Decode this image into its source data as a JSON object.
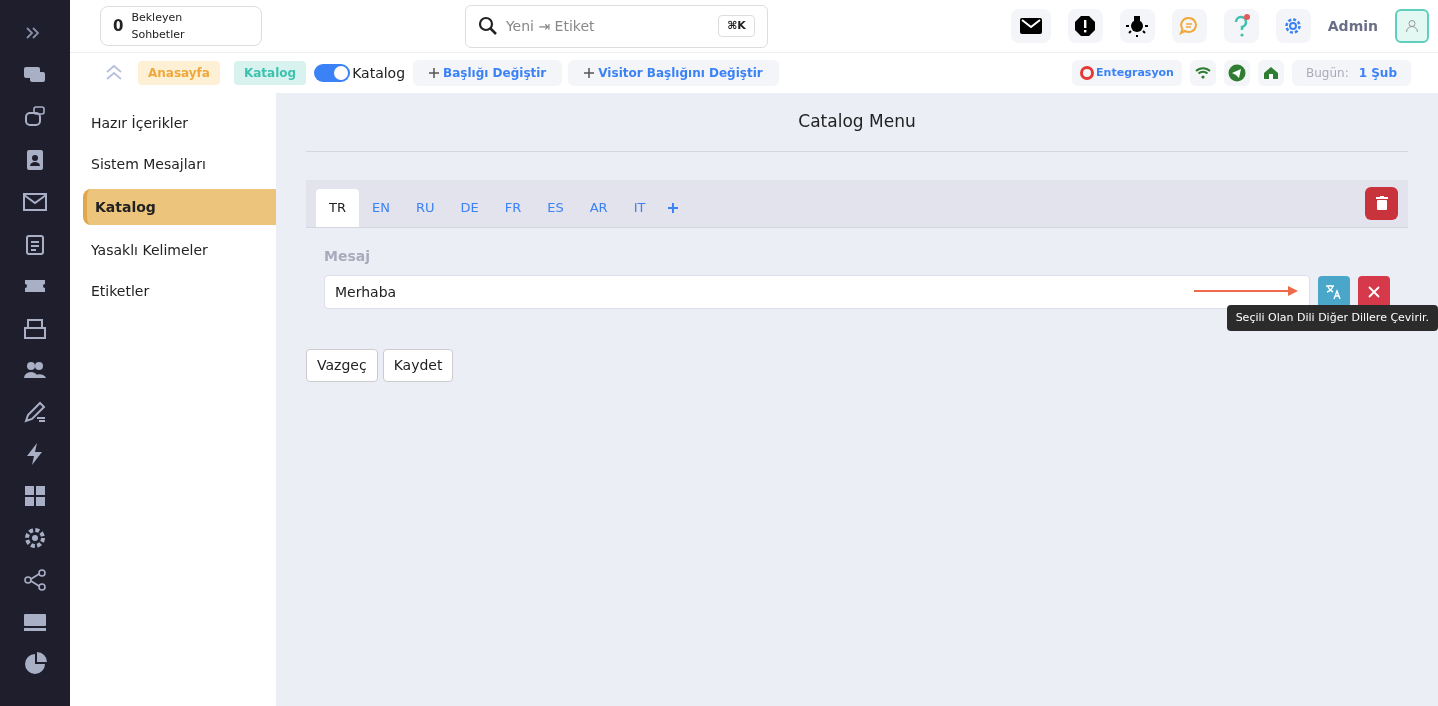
{
  "header": {
    "waiting": {
      "count": "0",
      "label": "Bekleyen Sohbetler"
    },
    "search": {
      "placeholder": "Yeni ⇥ Etiket",
      "shortcut": "⌘K"
    },
    "user": "Admin"
  },
  "toolbar": {
    "breadcrumbs": [
      {
        "label": "Anasayfa",
        "kind": "home"
      },
      {
        "label": "Katalog",
        "kind": "current"
      }
    ],
    "toggle": {
      "label": "Katalog",
      "on": true
    },
    "actions": [
      "Başlığı Değiştir",
      "Visitor Başlığını Değiştir"
    ],
    "integration": "Entegrasyon",
    "today_label": "Bugün:",
    "today_value": "1 Şub"
  },
  "menu": [
    {
      "label": "Hazır İçerikler",
      "selected": false
    },
    {
      "label": "Sistem Mesajları",
      "selected": false
    },
    {
      "label": "Katalog",
      "selected": true
    },
    {
      "label": "Yasaklı Kelimeler",
      "selected": false
    },
    {
      "label": "Etiketler",
      "selected": false
    }
  ],
  "title": "Catalog Menu",
  "tabs": [
    {
      "label": "TR",
      "selected": true
    },
    {
      "label": "EN",
      "selected": false
    },
    {
      "label": "RU",
      "selected": false
    },
    {
      "label": "DE",
      "selected": false
    },
    {
      "label": "FR",
      "selected": false
    },
    {
      "label": "ES",
      "selected": false
    },
    {
      "label": "AR",
      "selected": false
    },
    {
      "label": "IT",
      "selected": false
    }
  ],
  "field": {
    "label": "Mesaj",
    "value": "Merhaba"
  },
  "tooltip": "Seçili Olan Dili Diğer Dillere Çevirir.",
  "buttons": [
    "Vazgeç",
    "Kaydet"
  ]
}
